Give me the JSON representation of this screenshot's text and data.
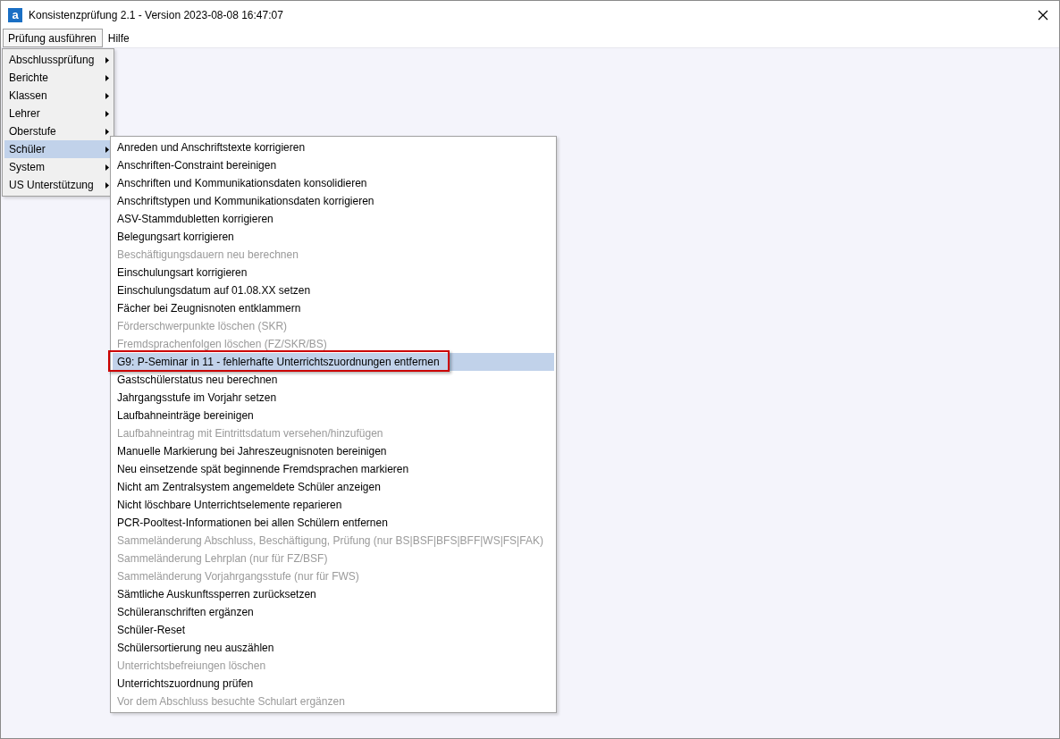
{
  "window": {
    "title": "Konsistenzprüfung 2.1 - Version 2023-08-08 16:47:07",
    "icon_letter": "a"
  },
  "menubar": [
    {
      "label": "Prüfung ausführen",
      "selected": true
    },
    {
      "label": "Hilfe",
      "selected": false
    }
  ],
  "menu": [
    {
      "label": "Abschlussprüfung",
      "selected": false,
      "has_submenu": true
    },
    {
      "label": "Berichte",
      "selected": false,
      "has_submenu": true
    },
    {
      "label": "Klassen",
      "selected": false,
      "has_submenu": true
    },
    {
      "label": "Lehrer",
      "selected": false,
      "has_submenu": true
    },
    {
      "label": "Oberstufe",
      "selected": false,
      "has_submenu": true
    },
    {
      "label": "Schüler",
      "selected": true,
      "has_submenu": true
    },
    {
      "label": "System",
      "selected": false,
      "has_submenu": true
    },
    {
      "label": "US Unterstützung",
      "selected": false,
      "has_submenu": true
    }
  ],
  "submenu": [
    {
      "label": "Anreden und Anschriftstexte korrigieren",
      "disabled": false,
      "selected": false,
      "marked": false
    },
    {
      "label": "Anschriften-Constraint bereinigen",
      "disabled": false,
      "selected": false,
      "marked": false
    },
    {
      "label": "Anschriften und Kommunikationsdaten konsolidieren",
      "disabled": false,
      "selected": false,
      "marked": false
    },
    {
      "label": "Anschriftstypen und Kommunikationsdaten korrigieren",
      "disabled": false,
      "selected": false,
      "marked": false
    },
    {
      "label": "ASV-Stammdubletten korrigieren",
      "disabled": false,
      "selected": false,
      "marked": false
    },
    {
      "label": "Belegungsart korrigieren",
      "disabled": false,
      "selected": false,
      "marked": false
    },
    {
      "label": "Beschäftigungsdauern neu berechnen",
      "disabled": true,
      "selected": false,
      "marked": false
    },
    {
      "label": "Einschulungsart korrigieren",
      "disabled": false,
      "selected": false,
      "marked": false
    },
    {
      "label": "Einschulungsdatum auf 01.08.XX setzen",
      "disabled": false,
      "selected": false,
      "marked": false
    },
    {
      "label": "Fächer bei Zeugnisnoten entklammern",
      "disabled": false,
      "selected": false,
      "marked": false
    },
    {
      "label": "Förderschwerpunkte löschen (SKR)",
      "disabled": true,
      "selected": false,
      "marked": false
    },
    {
      "label": "Fremdsprachenfolgen löschen (FZ/SKR/BS)",
      "disabled": true,
      "selected": false,
      "marked": false
    },
    {
      "label": "G9: P-Seminar in 11 - fehlerhafte Unterrichtszuordnungen entfernen",
      "disabled": false,
      "selected": true,
      "marked": true
    },
    {
      "label": "Gastschülerstatus neu berechnen",
      "disabled": false,
      "selected": false,
      "marked": false
    },
    {
      "label": "Jahrgangsstufe im Vorjahr setzen",
      "disabled": false,
      "selected": false,
      "marked": false
    },
    {
      "label": "Laufbahneinträge bereinigen",
      "disabled": false,
      "selected": false,
      "marked": false
    },
    {
      "label": "Laufbahneintrag mit Eintrittsdatum versehen/hinzufügen",
      "disabled": true,
      "selected": false,
      "marked": false
    },
    {
      "label": "Manuelle Markierung bei Jahreszeugnisnoten bereinigen",
      "disabled": false,
      "selected": false,
      "marked": false
    },
    {
      "label": "Neu einsetzende spät beginnende Fremdsprachen markieren",
      "disabled": false,
      "selected": false,
      "marked": false
    },
    {
      "label": "Nicht am Zentralsystem angemeldete Schüler anzeigen",
      "disabled": false,
      "selected": false,
      "marked": false
    },
    {
      "label": "Nicht löschbare Unterrichtselemente reparieren",
      "disabled": false,
      "selected": false,
      "marked": false
    },
    {
      "label": "PCR-Pooltest-Informationen bei allen Schülern entfernen",
      "disabled": false,
      "selected": false,
      "marked": false
    },
    {
      "label": "Sammeländerung Abschluss, Beschäftigung, Prüfung (nur BS|BSF|BFS|BFF|WS|FS|FAK)",
      "disabled": true,
      "selected": false,
      "marked": false
    },
    {
      "label": "Sammeländerung Lehrplan (nur für FZ/BSF)",
      "disabled": true,
      "selected": false,
      "marked": false
    },
    {
      "label": "Sammeländerung Vorjahrgangsstufe (nur für FWS)",
      "disabled": true,
      "selected": false,
      "marked": false
    },
    {
      "label": "Sämtliche Auskunftssperren zurücksetzen",
      "disabled": false,
      "selected": false,
      "marked": false
    },
    {
      "label": "Schüleranschriften ergänzen",
      "disabled": false,
      "selected": false,
      "marked": false
    },
    {
      "label": "Schüler-Reset",
      "disabled": false,
      "selected": false,
      "marked": false
    },
    {
      "label": "Schülersortierung neu auszählen",
      "disabled": false,
      "selected": false,
      "marked": false
    },
    {
      "label": "Unterrichtsbefreiungen löschen",
      "disabled": true,
      "selected": false,
      "marked": false
    },
    {
      "label": "Unterrichtszuordnung prüfen",
      "disabled": false,
      "selected": false,
      "marked": false
    },
    {
      "label": "Vor dem Abschluss besuchte Schulart ergänzen",
      "disabled": true,
      "selected": false,
      "marked": false
    }
  ]
}
